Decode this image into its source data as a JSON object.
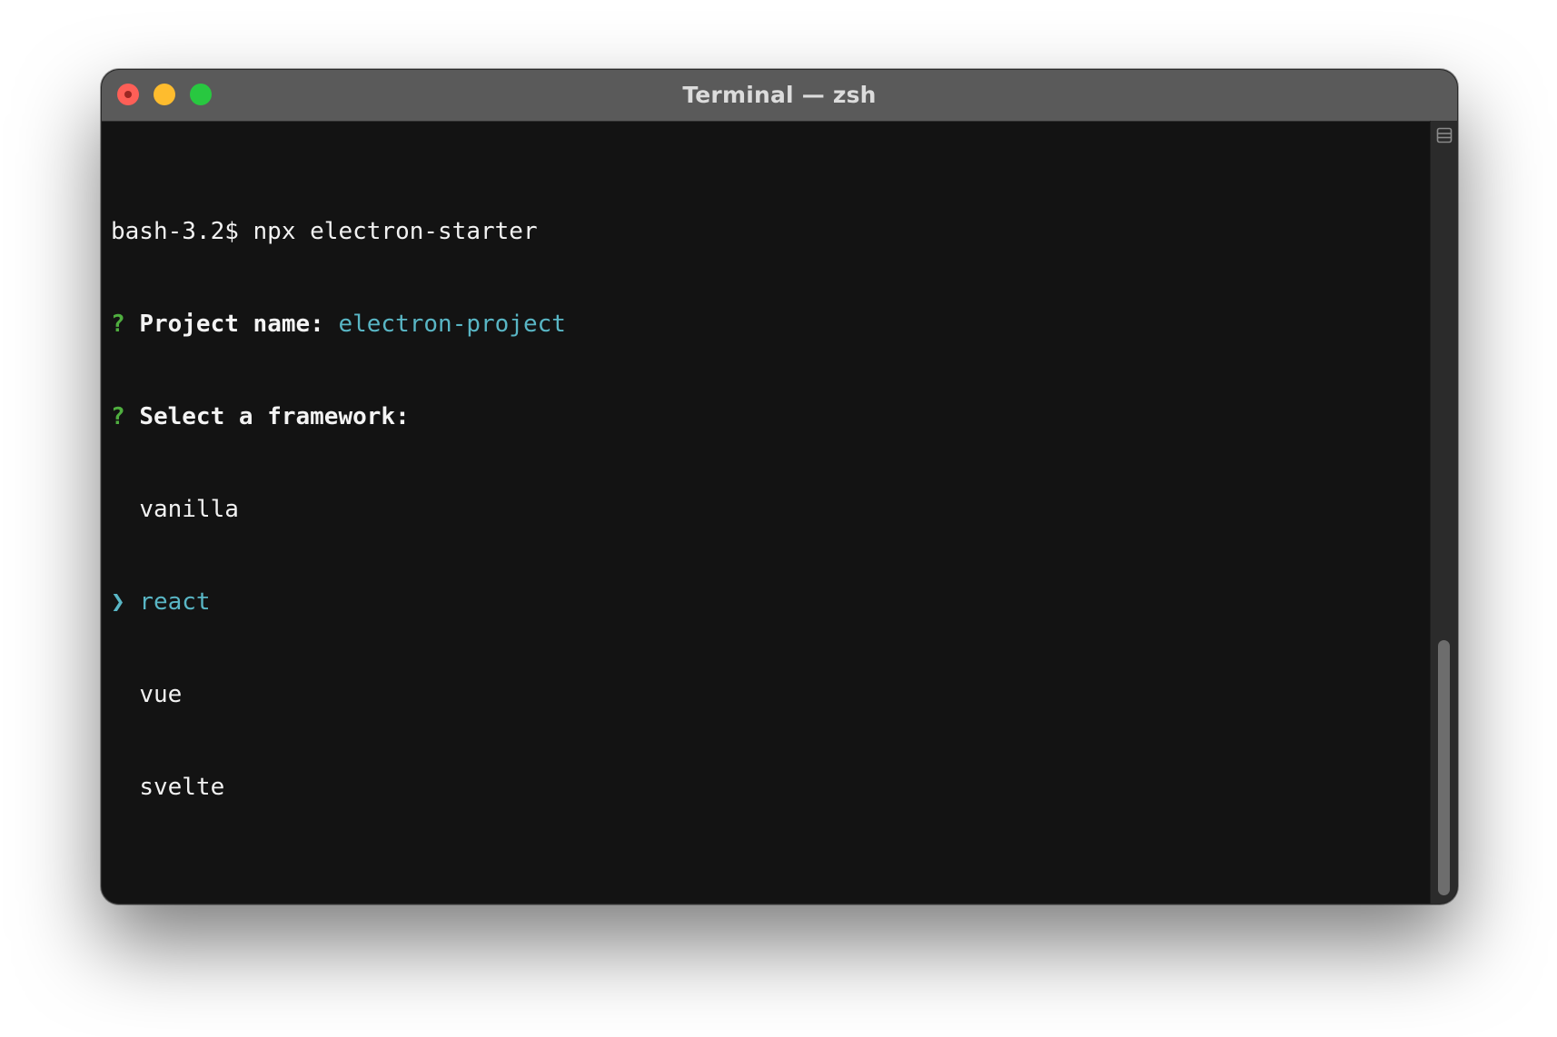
{
  "window": {
    "title": "Terminal — zsh"
  },
  "terminal": {
    "command_line": "bash-3.2$ npx electron-starter",
    "project_prompt": {
      "marker": "?",
      "label": "Project name:",
      "value": "electron-project"
    },
    "framework_prompt": {
      "marker": "?",
      "label": "Select a framework:"
    },
    "options": [
      {
        "label": "vanilla",
        "pointer": " ",
        "selected": false
      },
      {
        "label": "react",
        "pointer": "❯",
        "selected": true
      },
      {
        "label": "vue",
        "pointer": " ",
        "selected": false
      },
      {
        "label": "svelte",
        "pointer": " ",
        "selected": false
      }
    ]
  },
  "colors": {
    "close": "#fe5f57",
    "minimize": "#febc2e",
    "zoom": "#28c840",
    "prompt_marker": "#4fae3f",
    "accent": "#59b6c5",
    "terminal_background": "#131313",
    "titlebar": "#5a5a5a"
  },
  "icons": {
    "close": "close-icon",
    "minimize": "minimize-icon",
    "zoom": "zoom-icon",
    "split_view": "split-pane-icon"
  },
  "scroll": {
    "thumb_position_fraction": 0.72,
    "thumb_size_fraction": 0.33
  }
}
